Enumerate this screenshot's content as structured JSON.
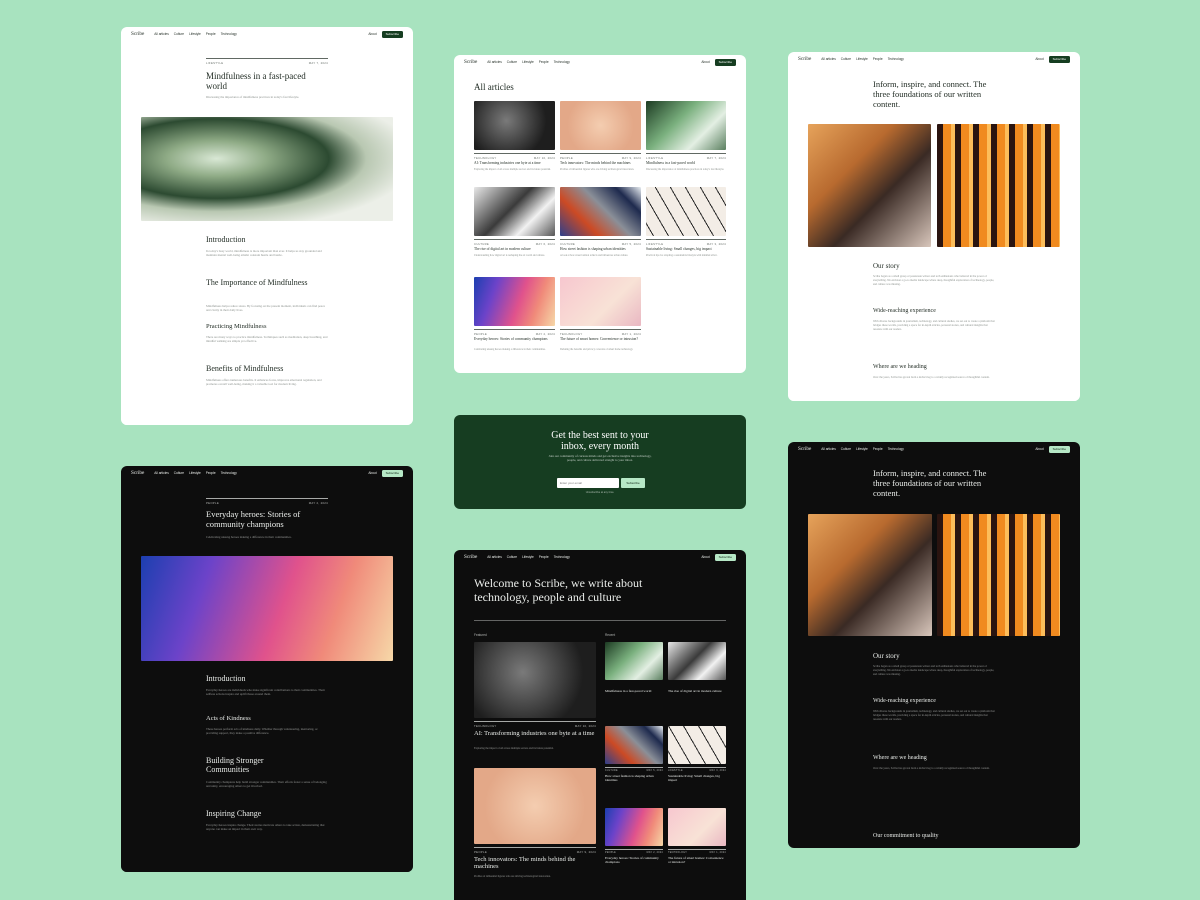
{
  "brand": "Scribe",
  "nav": [
    "All articles",
    "Culture",
    "Lifestyle",
    "People",
    "Technology"
  ],
  "about_label": "About",
  "subscribe_label": "Subscribe",
  "colors": {
    "background": "#a8e3bf",
    "brand_dark_green": "#163d21",
    "accent_mint": "#b6e8c6",
    "dark_surface": "#0d0d0d"
  },
  "article_light": {
    "tag": "LIFESTYLE",
    "date": "MAY 7, 2024",
    "title": "Mindfulness in a fast-paced world",
    "subtitle": "Discussing the importance of mindfulness practices in today's fast lifestyle.",
    "sections": [
      {
        "heading": "Introduction",
        "body": "In today's busy world, mindfulness is more important than ever. It helps us stay grounded and maintain mental well-being amidst constant hustle and bustle."
      },
      {
        "heading": "The Importance of Mindfulness",
        "body": "Mindfulness helps reduce stress. By focusing on the present moment, individuals can find peace and clarity in their daily lives."
      },
      {
        "heading": "Practicing Mindfulness",
        "body": "There are many ways to practice mindfulness. Techniques such as meditation, deep breathing, and mindful walking are simple yet effective."
      },
      {
        "heading": "Benefits of Mindfulness",
        "body": "Mindfulness offers numerous benefits. It enhances focus, improves emotional regulation, and promotes overall well-being, making it a valuable tool for modern living."
      }
    ]
  },
  "all_articles": {
    "heading": "All articles",
    "items": [
      {
        "tag": "TECHNOLOGY",
        "date": "MAY 10, 2024",
        "title": "AI: Transforming industries one byte at a time",
        "excerpt": "Exploring the impact of AI across multiple sectors and its future potential."
      },
      {
        "tag": "PEOPLE",
        "date": "MAY 9, 2024",
        "title": "Tech innovators: The minds behind the machines",
        "excerpt": "Profiles of influential figures who are driving technological innovation."
      },
      {
        "tag": "LIFESTYLE",
        "date": "MAY 7, 2024",
        "title": "Mindfulness in a fast-paced world",
        "excerpt": "Discussing the importance of mindfulness practices in today's fast lifestyle."
      },
      {
        "tag": "CULTURE",
        "date": "MAY 6, 2024",
        "title": "The rise of digital art in modern culture",
        "excerpt": "Understanding how digital art is reshaping the art world and culture."
      },
      {
        "tag": "CULTURE",
        "date": "MAY 5, 2024",
        "title": "How street fashion is shaping urban identities",
        "excerpt": "A look at how street fashion reflects and influences urban culture."
      },
      {
        "tag": "LIFESTYLE",
        "date": "MAY 3, 2024",
        "title": "Sustainable living: Small changes, big impact",
        "excerpt": "Practical tips for adopting a sustainable lifestyle with minimal effort."
      },
      {
        "tag": "PEOPLE",
        "date": "MAY 2, 2024",
        "title": "Everyday heroes: Stories of community champions",
        "excerpt": "Celebrating unsung heroes making a difference in their communities."
      },
      {
        "tag": "TECHNOLOGY",
        "date": "MAY 1, 2024",
        "title": "The future of smart homes: Convenience or intrusion?",
        "excerpt": "Debating the benefits and privacy concerns of smart home technology."
      }
    ]
  },
  "about": {
    "heading": "Inform, inspire, and connect. The three foundations of our written content.",
    "sections": [
      {
        "heading": "Our story",
        "body": "Scribe began as a small group of passionate writers and tech enthusiasts who believed in the power of storytelling. We envision a go-to media landscape where deep, thoughtful exploration of technology, people, and culture was missing."
      },
      {
        "heading": "Wide-reaching experience",
        "body": "With diverse backgrounds in journalism, technology, and cultural studies, we set out to create a platform that bridges these worlds, providing a space for in-depth articles, personal stories, and cultural insights that resonate with our readers."
      },
      {
        "heading": "Where are we heading",
        "body": "Over the years, Scribe has grown from a niche blog to a widely recognized source of thoughtful content."
      }
    ],
    "commitment": "Our commitment to quality"
  },
  "newsletter": {
    "heading": "Get the best sent to your inbox, every month",
    "body": "Join our community of curious minds and get exclusive insights into technology, people, and culture delivered straight to your inbox.",
    "placeholder": "Enter your email",
    "button": "Subscribe",
    "note": "Unsubscribe at any time."
  },
  "article_dark": {
    "tag": "PEOPLE",
    "date": "MAY 2, 2024",
    "title": "Everyday heroes: Stories of community champions",
    "subtitle": "Celebrating unsung heroes making a difference in their communities.",
    "sections": [
      {
        "heading": "Introduction",
        "body": "Everyday heroes are individuals who make significant contributions to their communities. Their selfless actions inspire and uplift those around them."
      },
      {
        "heading": "Acts of Kindness",
        "body": "These heroes perform acts of kindness daily. Whether through volunteering, mentoring, or providing support, they make a positive difference."
      },
      {
        "heading": "Building Stronger Communities",
        "body": "Community champions help build stronger communities. Their efforts foster a sense of belonging and unity, encouraging others to get involved."
      },
      {
        "heading": "Inspiring Change",
        "body": "Everyday heroes inspire change. Their stories motivate others to take action, demonstrating that anyone can make an impact in their own way."
      }
    ]
  },
  "home_dark": {
    "heading": "Welcome to Scribe, we write about technology, people and culture",
    "featured_label": "Featured",
    "recent_label": "Recent",
    "featured": [
      {
        "tag": "TECHNOLOGY",
        "date": "MAY 10, 2024",
        "title": "AI: Transforming industries one byte at a time",
        "excerpt": "Exploring the impact of AI across multiple sectors and its future potential."
      },
      {
        "tag": "PEOPLE",
        "date": "MAY 9, 2024",
        "title": "Tech innovators: The minds behind the machines",
        "excerpt": "Profiles of influential figures who are driving technological innovation."
      }
    ],
    "recent": [
      {
        "tag": "LIFESTYLE",
        "date": "MAY 7, 2024",
        "title": "Mindfulness in a fast-paced world"
      },
      {
        "tag": "CULTURE",
        "date": "MAY 6, 2024",
        "title": "The rise of digital art in modern culture"
      },
      {
        "tag": "CULTURE",
        "date": "MAY 5, 2024",
        "title": "How street fashion is shaping urban identities"
      },
      {
        "tag": "LIFESTYLE",
        "date": "MAY 3, 2024",
        "title": "Sustainable living: Small changes, big impact"
      },
      {
        "tag": "PEOPLE",
        "date": "MAY 2, 2024",
        "title": "Everyday heroes: Stories of community champions"
      },
      {
        "tag": "TECHNOLOGY",
        "date": "MAY 1, 2024",
        "title": "The future of smart homes: Convenience or intrusion?"
      }
    ]
  }
}
